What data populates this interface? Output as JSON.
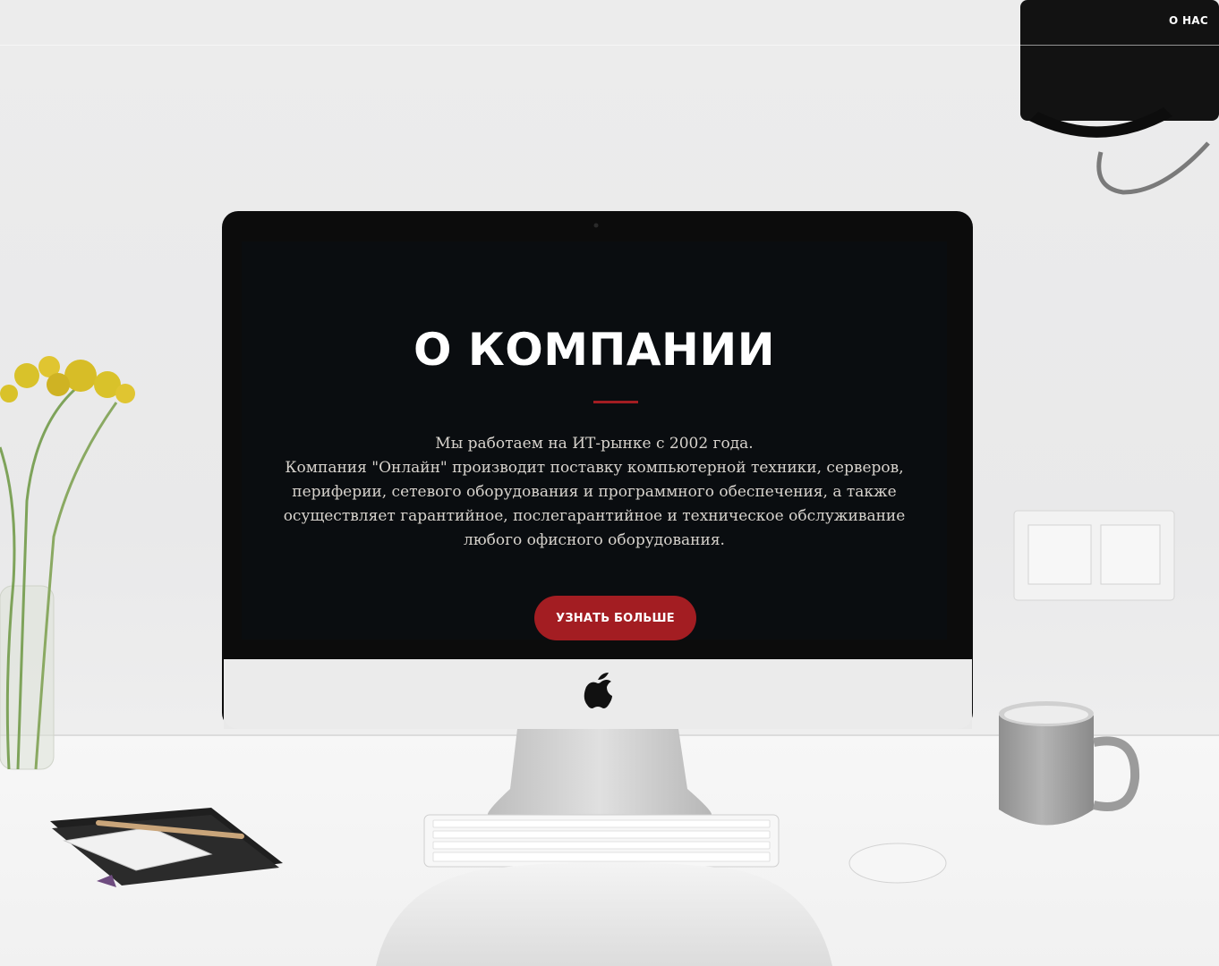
{
  "nav": {
    "about_label": "О НАС"
  },
  "hero": {
    "title": "О КОМПАНИИ",
    "lines": [
      "Мы работаем на ИТ-рынке с 2002 года.",
      "Компания \"Онлайн\" производит поставку компьютерной техники, серверов,",
      "периферии, сетевого оборудования и программного обеспечения, а также",
      "осуществляет гарантийное, послегарантийное и техническое обслуживание",
      "любого офисного оборудования."
    ],
    "cta_label": "УЗНАТЬ БОЛЬШЕ"
  },
  "colors": {
    "accent": "#a31d22",
    "screen": "#0a0d10",
    "wall": "#ebebeb",
    "text_light": "#ffffff"
  }
}
